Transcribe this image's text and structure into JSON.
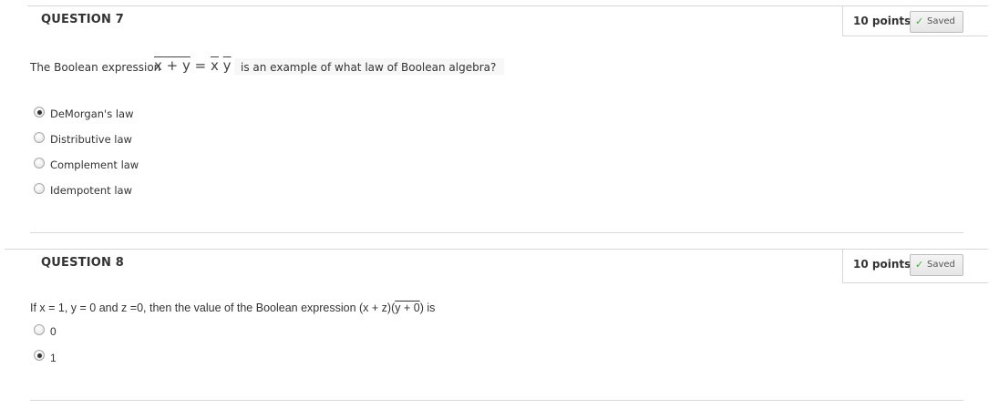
{
  "questions": [
    {
      "title": "QUESTION 7",
      "points": "10 points",
      "status": "Saved",
      "status_icon": "check-icon",
      "prompt_before": "The Boolean expression",
      "formula_lhs": "x + y",
      "formula_eq": "=",
      "formula_rhs_a": "x",
      "formula_rhs_b": "y",
      "prompt_after": "is an example of what law of Boolean algebra?",
      "options": [
        {
          "label": "DeMorgan's law",
          "selected": true
        },
        {
          "label": "Distributive law",
          "selected": false
        },
        {
          "label": "Complement law",
          "selected": false
        },
        {
          "label": "Idempotent law",
          "selected": false
        }
      ]
    },
    {
      "title": "QUESTION 8",
      "points": "10 points",
      "status": "Saved",
      "status_icon": "check-icon",
      "prompt_before": "If x = 1,  y = 0 and   z =0, then the value of the Boolean expression (x + z)(",
      "prompt_overbar": "y + 0",
      "prompt_after": ") is",
      "options": [
        {
          "label": "0",
          "selected": false
        },
        {
          "label": "1",
          "selected": true
        }
      ]
    }
  ]
}
